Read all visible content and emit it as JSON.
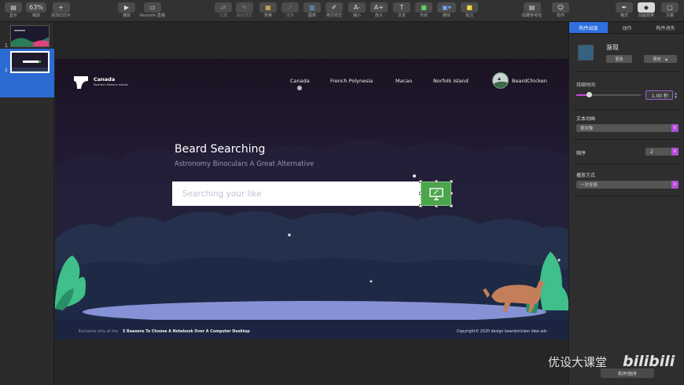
{
  "toolbar": {
    "items": [
      {
        "label": "显示",
        "icon": "view-icon"
      },
      {
        "label": "缩放",
        "value": "63%",
        "icon": "zoom-icon"
      },
      {
        "label": "添加幻灯片",
        "icon": "add-slide-icon"
      },
      {
        "label": "播放",
        "icon": "play-icon"
      },
      {
        "label": "Keynote 直播",
        "icon": "keynote-live-icon"
      },
      {
        "label": "过渡",
        "icon": "transition-icon"
      },
      {
        "label": "粘贴样式",
        "icon": "paste-style-icon"
      },
      {
        "label": "表格",
        "icon": "table-icon"
      },
      {
        "label": "连接",
        "icon": "connect-icon"
      },
      {
        "label": "图表",
        "icon": "chart-icon"
      },
      {
        "label": "拷贝样式",
        "icon": "copy-style-icon"
      },
      {
        "label": "缩小",
        "icon": "shrink-icon"
      },
      {
        "label": "放大",
        "icon": "enlarge-icon"
      },
      {
        "label": "文本",
        "icon": "text-icon"
      },
      {
        "label": "形状",
        "icon": "shape-icon"
      },
      {
        "label": "媒体",
        "icon": "media-icon"
      },
      {
        "label": "批注",
        "icon": "comment-icon"
      },
      {
        "label": "隐藏参考线",
        "icon": "hide-guides-icon"
      },
      {
        "label": "协作",
        "icon": "collaborate-icon"
      },
      {
        "label": "格式",
        "icon": "format-icon"
      },
      {
        "label": "动画效果",
        "icon": "animate-icon"
      },
      {
        "label": "文稿",
        "icon": "document-icon"
      }
    ]
  },
  "navigator": {
    "slides": [
      {
        "number": "1"
      },
      {
        "number": "2"
      }
    ]
  },
  "slide": {
    "brand": {
      "title": "Canada",
      "subtitle": "Northern Mariana Islands"
    },
    "menu": [
      "Canada",
      "French Polynesia",
      "Macao",
      "Norfolk Island"
    ],
    "user": "BeardChicken",
    "hero_title": "Beard Searching",
    "hero_subtitle": "Astronomy Binoculars A Great Alternative",
    "search_placeholder": "Searching your like",
    "footer_left": "Exclusive only at the",
    "footer_link": "5 Reasons To Choose A Notebook Over A Computer Desktop",
    "footer_right": "Copyright© 2020 design beardchicken idea adc",
    "colors": {
      "search_button": "#4ba64b",
      "accent": "#2f6fe0"
    }
  },
  "inspector": {
    "tabs": [
      "构件出现",
      "动作",
      "构件消失"
    ],
    "effect_name": "渐现",
    "change_label": "更改",
    "preview_label": "预览",
    "duration_label": "持续时间",
    "duration_value": "1.00 秒",
    "text_animation_label": "文本动画",
    "text_animation_value": "按对象",
    "order_label": "顺序",
    "order_value": "2",
    "delivery_label": "播放方式",
    "delivery_value": "一次全部",
    "build_order_label": "构件顺序"
  },
  "watermark": {
    "text": "优设大课堂",
    "logo": "bilibili"
  }
}
